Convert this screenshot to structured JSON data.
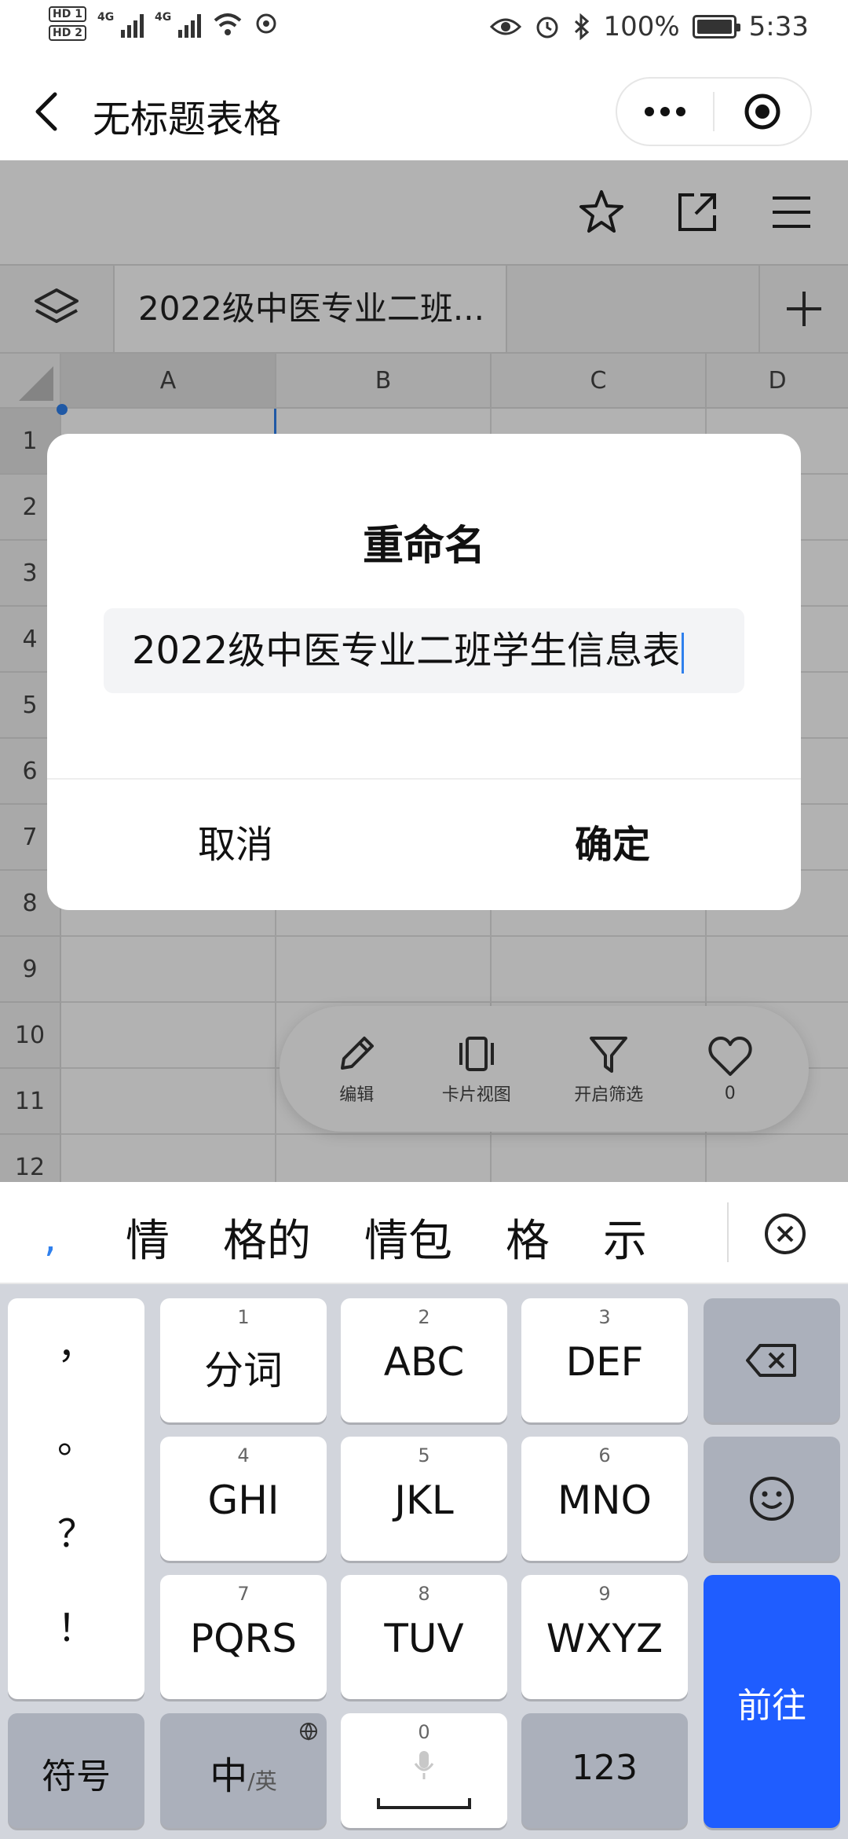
{
  "status_bar": {
    "sim1": "HD 1",
    "sim2": "HD 2",
    "net1": "4G",
    "net2": "4G",
    "battery": "100%",
    "time": "5:33"
  },
  "title_bar": {
    "title": "无标题表格"
  },
  "sheet": {
    "tab_label": "2022级中医专业二班...",
    "columns": [
      "A",
      "B",
      "C",
      "D"
    ],
    "rows": [
      "1",
      "2",
      "3",
      "4",
      "5",
      "6",
      "7",
      "8",
      "9",
      "10",
      "11",
      "12"
    ]
  },
  "bottom_toolbar": {
    "edit": "编辑",
    "card_view": "卡片视图",
    "filter": "开启筛选",
    "likes": "0"
  },
  "dialog": {
    "title": "重命名",
    "input_value": "2022级中医专业二班学生信息表",
    "cancel": "取消",
    "confirm": "确定"
  },
  "candidates": {
    "comma": ",",
    "items": [
      "情",
      "格的",
      "情包",
      "格",
      "示"
    ]
  },
  "keyboard": {
    "punct": [
      "，",
      "。",
      "？",
      "！"
    ],
    "keys": [
      {
        "num": "1",
        "label": "分词"
      },
      {
        "num": "2",
        "label": "ABC"
      },
      {
        "num": "3",
        "label": "DEF"
      },
      {
        "num": "4",
        "label": "GHI"
      },
      {
        "num": "5",
        "label": "JKL"
      },
      {
        "num": "6",
        "label": "MNO"
      },
      {
        "num": "7",
        "label": "PQRS"
      },
      {
        "num": "8",
        "label": "TUV"
      },
      {
        "num": "9",
        "label": "WXYZ"
      }
    ],
    "symbols": "符号",
    "lang_main": "中",
    "lang_sub": "/英",
    "space_num": "0",
    "numbers": "123",
    "go": "前往"
  },
  "colors": {
    "accent": "#2f80ed",
    "go_key": "#1f5dff",
    "keyboard_bg": "#d2d5dc"
  }
}
